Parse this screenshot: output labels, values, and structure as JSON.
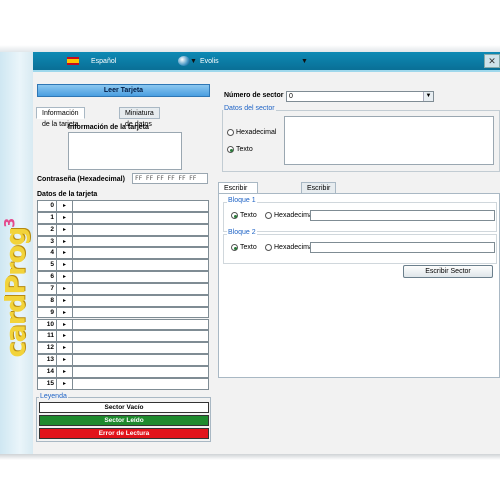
{
  "app": {
    "language": "Español",
    "device": "Evolis",
    "logo_text": "cardProg",
    "logo_version": "3"
  },
  "left": {
    "read_button": "Leer Tarjeta",
    "tabs": [
      "Información de la tarjeta",
      "Miniatura de datos"
    ],
    "info_title": "Información de la tarjeta",
    "password_label": "Contraseña (Hexadecimal)",
    "password_value": "FF FF FF FF FF FF",
    "data_title": "Datos de la tarjeta",
    "rows": [
      "0",
      "1",
      "2",
      "3",
      "4",
      "5",
      "6",
      "7",
      "8",
      "9",
      "10",
      "11",
      "12",
      "13",
      "14",
      "15"
    ],
    "row_arrow": "▸",
    "legend_title": "Leyenda",
    "legend": [
      {
        "label": "Sector Vacío",
        "color": "#ffffff",
        "text_color": "#000000"
      },
      {
        "label": "Sector Leído",
        "color": "#1f8a2e",
        "text_color": "#ffffff"
      },
      {
        "label": "Error de Lectura",
        "color": "#e2131b",
        "text_color": "#ffffff"
      }
    ]
  },
  "right": {
    "sector_label": "Número de sector",
    "sector_value": "0",
    "sector_data_title": "Datos del sector",
    "radio_hex": "Hexadecimal",
    "radio_text": "Texto",
    "tabs": [
      "Escribir sector completo",
      "Escribir bloque"
    ],
    "block1_title": "Bloque 1",
    "block2_title": "Bloque 2",
    "block_radio_text": "Texto",
    "block_radio_hex": "Hexadecimal",
    "write_button": "Escribir Sector"
  },
  "colors": {
    "topbar": "#0a7ea8",
    "accent_link": "#1e63c6"
  }
}
